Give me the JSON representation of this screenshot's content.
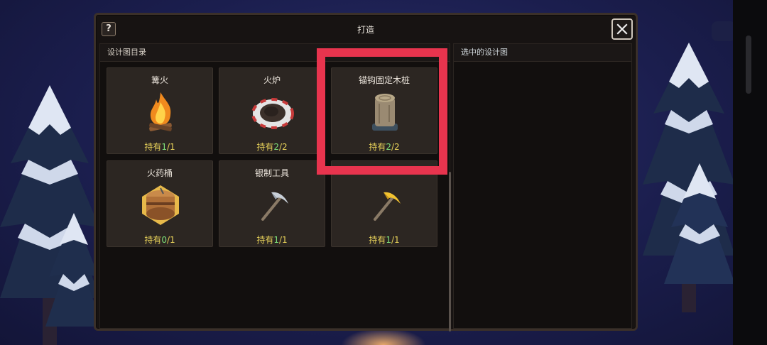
{
  "window": {
    "title": "打造",
    "help_label": "?"
  },
  "catalog": {
    "header": "设计图目录",
    "items": [
      {
        "name": "篝火",
        "held_prefix": "持有",
        "held_current": "1",
        "held_total": "/1",
        "icon": "campfire-icon"
      },
      {
        "name": "火炉",
        "held_prefix": "持有",
        "held_current": "2",
        "held_total": "/2",
        "icon": "furnace-icon"
      },
      {
        "name": "锚钩固定木桩",
        "held_prefix": "持有",
        "held_current": "2",
        "held_total": "/2",
        "icon": "wooden-stake-icon"
      },
      {
        "name": "火药桶",
        "held_prefix": "持有",
        "held_current": "0",
        "held_total": "/1",
        "icon": "powder-keg-icon"
      },
      {
        "name": "银制工具",
        "held_prefix": "持有",
        "held_current": "1",
        "held_total": "/1",
        "icon": "silver-pickaxe-icon"
      },
      {
        "name": "",
        "held_prefix": "持有",
        "held_current": "1",
        "held_total": "/1",
        "icon": "gold-pickaxe-icon"
      }
    ]
  },
  "selected": {
    "header": "选中的设计图"
  },
  "colors": {
    "highlight": "#e8344e",
    "held_current": "#7ee07a",
    "held_text": "#e9d35a"
  }
}
